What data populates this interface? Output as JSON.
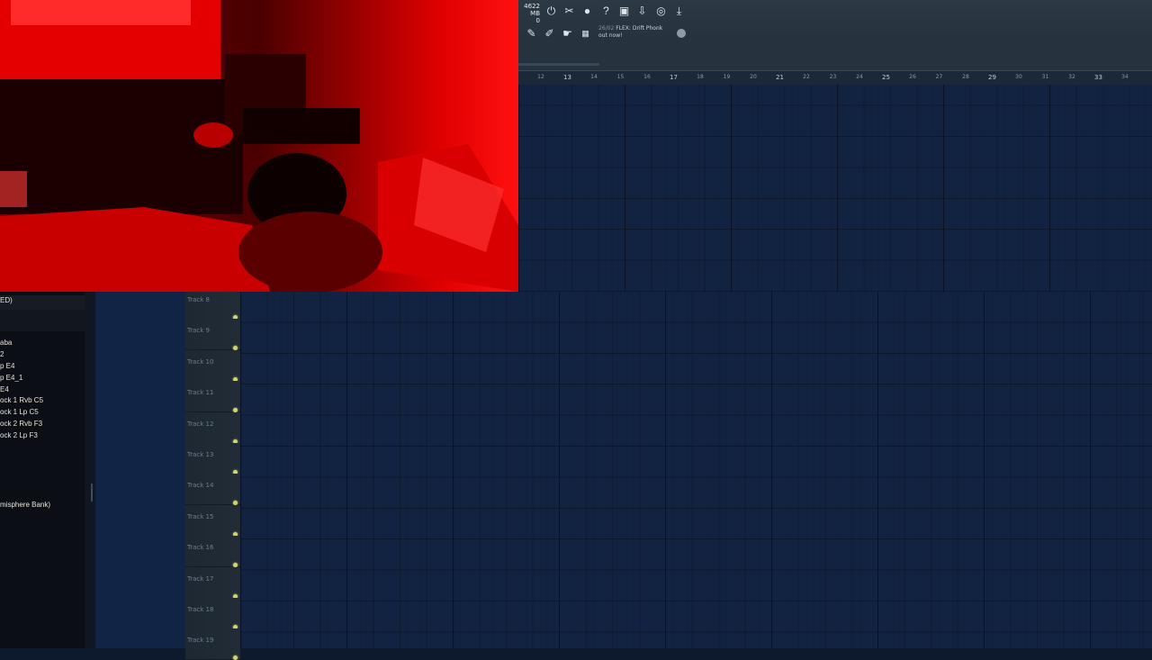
{
  "toolbar": {
    "memory": "4622 MB",
    "memory_sub": "0",
    "news_date": "26/02",
    "news_title": "FLEX: Drift Phonk",
    "news_sub": "out now!"
  },
  "ruler": {
    "major": [
      "13",
      "17",
      "21",
      "25",
      "29",
      "33"
    ],
    "minor": [
      "12",
      "14",
      "15",
      "16",
      "18",
      "19",
      "20",
      "22",
      "23",
      "24",
      "26",
      "27",
      "28",
      "30",
      "31",
      "32",
      "34"
    ]
  },
  "browser": {
    "items": [
      "ED)",
      "aba",
      "2",
      "p E4",
      "p E4_1",
      "E4",
      "ock 1  Rvb C5",
      "ock 1  Lp C5",
      "ock 2  Rvb F3",
      "ock 2  Lp F3",
      "misphere Bank)"
    ]
  },
  "tracks": [
    "Track 8",
    "Track 9",
    "Track 10",
    "Track 11",
    "Track 12",
    "Track 13",
    "Track 14",
    "Track 15",
    "Track 16",
    "Track 17",
    "Track 18",
    "Track 19"
  ],
  "colors": {
    "grid_bg": "#122342",
    "webcam_tint": "#ff0000",
    "track_led": "#d3d46b"
  }
}
